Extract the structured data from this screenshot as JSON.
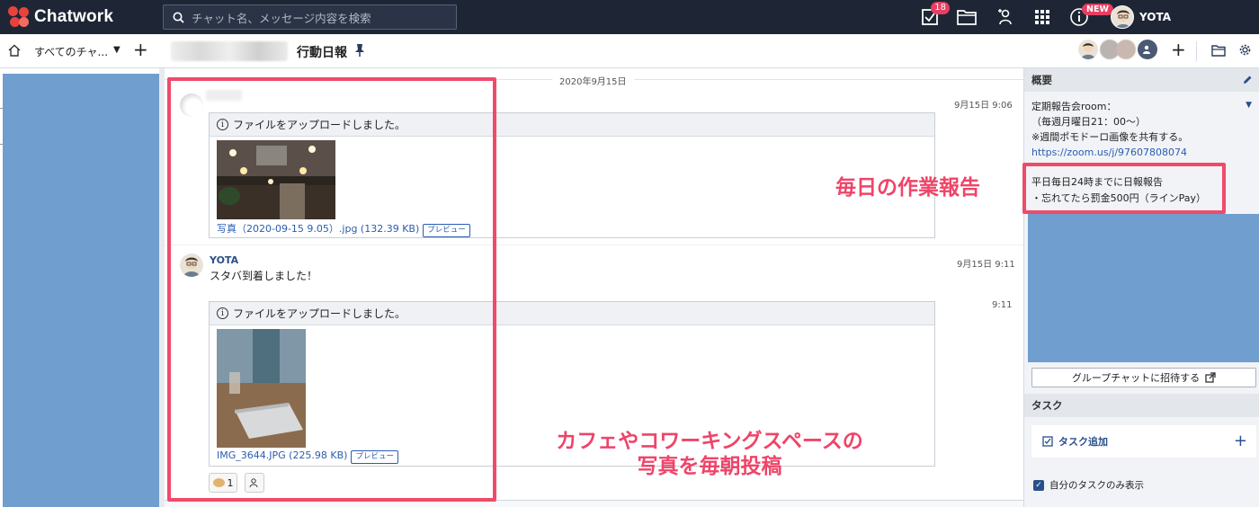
{
  "app": {
    "name": "Chatwork",
    "user": "YOTA",
    "task_badge": "18",
    "new_badge": "NEW"
  },
  "search": {
    "placeholder": "チャット名、メッセージ内容を検索"
  },
  "subbar": {
    "all_chats": "すべてのチャ...",
    "room_title": "行動日報"
  },
  "chat": {
    "date_label": "2020年9月15日",
    "messages": [
      {
        "time": "9月15日 9:06",
        "upload_notice": "ファイルをアップロードしました。",
        "file_name": "写真（2020-09-15 9.05）.jpg (132.39 KB)",
        "preview": "プレビュー"
      },
      {
        "user": "YOTA",
        "time": "9月15日 9:11",
        "text": "スタバ到着しました！"
      },
      {
        "time": "9:11",
        "upload_notice": "ファイルをアップロードしました。",
        "file_name": "IMG_3644.JPG (225.98 KB)",
        "preview": "プレビュー",
        "reaction_count": "1"
      }
    ]
  },
  "annotations": {
    "morning_photo_line1": "カフェやコワーキングスペースの",
    "morning_photo_line2": "写真を毎朝投稿",
    "daily_report": "毎日の作業報告"
  },
  "right_panel": {
    "overview_title": "概要",
    "summary_lines": [
      "定期報告会room：",
      "（毎週月曜日21：00〜）",
      "※週間ポモドーロ画像を共有する。"
    ],
    "zoom_link": "https://zoom.us/j/97607808074",
    "rules_lines": [
      "平日毎日24時までに日報報告",
      "・忘れてたら罰金500円（ラインPay）"
    ],
    "invite_button": "グループチャットに招待する",
    "task_title": "タスク",
    "task_add": "タスク追加",
    "task_filter": "自分のタスクのみ表示"
  },
  "colors": {
    "topbar": "#1e2635",
    "accent": "#ef4468",
    "link": "#2a5db0",
    "blur_blue": "#6f9ecf"
  }
}
